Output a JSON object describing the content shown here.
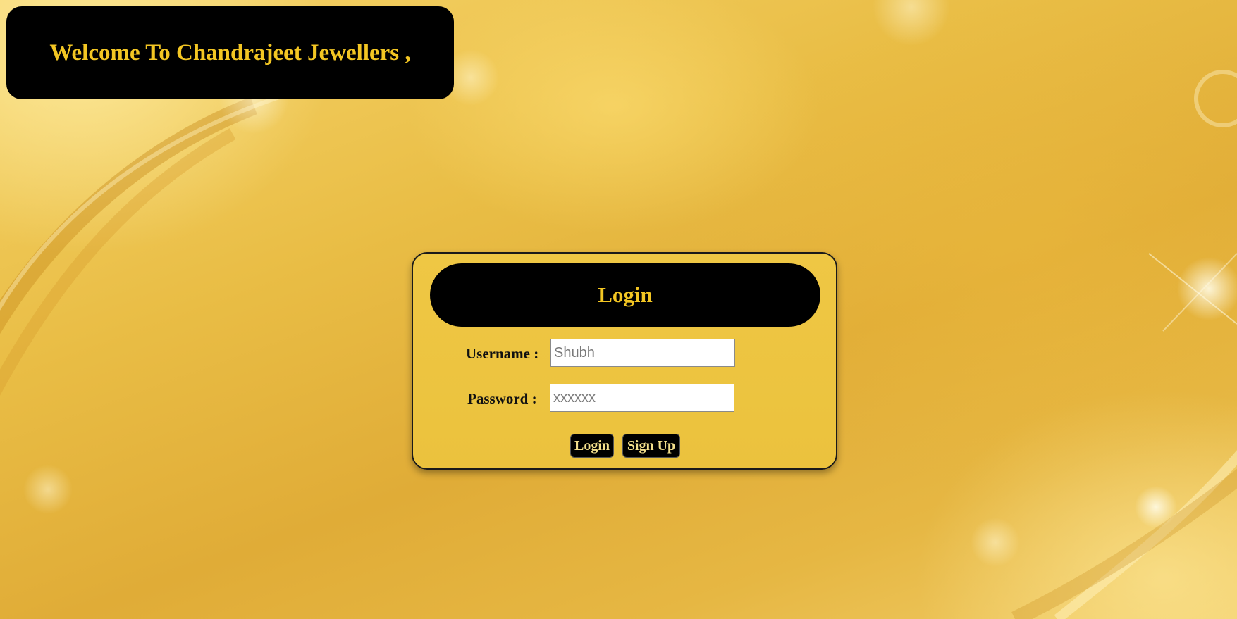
{
  "header": {
    "welcome_text": "Welcome To Chandrajeet Jewellers ,"
  },
  "login": {
    "title": "Login",
    "username": {
      "label": "Username :",
      "placeholder": "Shubh",
      "value": ""
    },
    "password": {
      "label": "Password :",
      "placeholder": "xxxxxx",
      "value": ""
    },
    "buttons": {
      "login_label": "Login",
      "signup_label": "Sign Up"
    }
  },
  "colors": {
    "accent_gold": "#f3c623",
    "panel_black": "#000000",
    "background_gold": "#e9bd45"
  }
}
